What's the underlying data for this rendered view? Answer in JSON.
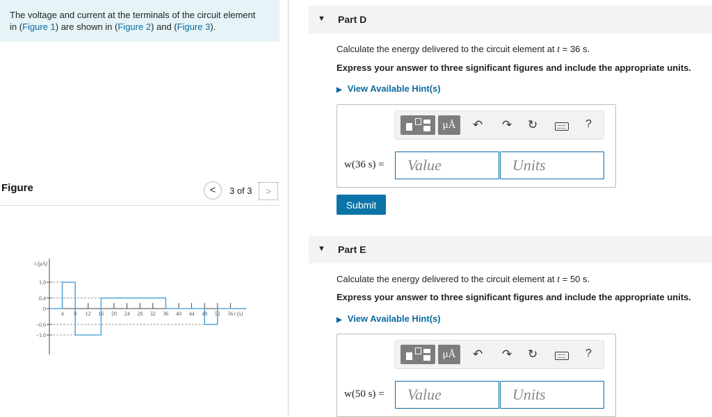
{
  "prompt": {
    "line1": "The voltage and current at the terminals of the circuit element",
    "in_text": "in (",
    "fig1": "Figure 1",
    "mid1": ") are shown in (",
    "fig2": "Figure 2",
    "mid2": ") and (",
    "fig3": "Figure 3",
    "end": ")."
  },
  "figure": {
    "title": "Figure",
    "prev_icon": "<",
    "counter": "3 of 3",
    "next_icon": ">"
  },
  "chart_data": {
    "type": "line",
    "ylabel": "i (μA)",
    "xlabel": "t (s)",
    "x_ticks": [
      "4",
      "8",
      "12",
      "16",
      "20",
      "24",
      "28",
      "32",
      "36",
      "40",
      "44",
      "48",
      "52",
      "56"
    ],
    "y_ticks": [
      "1.0",
      "0.4",
      "0",
      "-0.6",
      "-1.0"
    ],
    "xlim": [
      0,
      60
    ],
    "ylim": [
      -1.0,
      1.0
    ],
    "series": [
      {
        "x": [
          0,
          4,
          4,
          8,
          8,
          16,
          16,
          36,
          36,
          48,
          48,
          52,
          52,
          60
        ],
        "y": [
          0,
          0,
          1.0,
          1.0,
          -1.0,
          -1.0,
          0.4,
          0.4,
          0,
          0,
          -0.6,
          -0.6,
          0,
          0
        ]
      }
    ]
  },
  "parts": [
    {
      "title": "Part D",
      "question_pre": "Calculate the energy delivered to the circuit element at ",
      "t_var": "t",
      "question_post": " = 36 s.",
      "instructions": "Express your answer to three significant figures and include the appropriate units.",
      "hint": "View Available Hint(s)",
      "answer_label": "w(36 s) =",
      "value_placeholder": "Value",
      "units_placeholder": "Units",
      "submit": "Submit"
    },
    {
      "title": "Part E",
      "question_pre": "Calculate the energy delivered to the circuit element at ",
      "t_var": "t",
      "question_post": " = 50 s.",
      "instructions": "Express your answer to three significant figures and include the appropriate units.",
      "hint": "View Available Hint(s)",
      "answer_label": "w(50 s) =",
      "value_placeholder": "Value",
      "units_placeholder": "Units"
    }
  ],
  "toolbar": {
    "mu_label": "μÅ",
    "undo_icon": "↶",
    "redo_icon": "↷",
    "reset_icon": "↻",
    "help": "?"
  },
  "colors": {
    "accent": "#0a6aa1",
    "submit_bg": "#0a74a8",
    "prompt_bg": "#e6f4f7",
    "chart_line": "#5aa9dc"
  }
}
